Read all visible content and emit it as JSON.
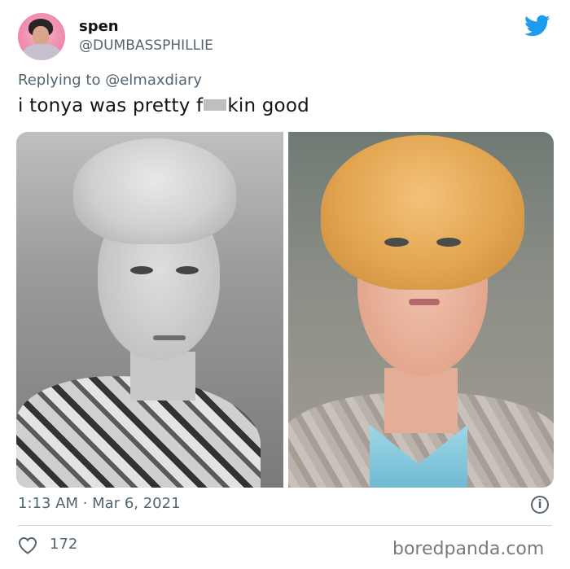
{
  "user": {
    "display_name": "spen",
    "handle": "@DUMBASSPHILLIE"
  },
  "reply": {
    "prefix": "Replying to",
    "mention": "@elmaxdiary"
  },
  "tweet": {
    "text_before": "i tonya was pretty f",
    "text_after": "kin good"
  },
  "meta": {
    "timestamp": "1:13 AM · Mar 6, 2021"
  },
  "engagement": {
    "likes": "172"
  },
  "watermark": "boredpanda.com",
  "icons": {
    "brand": "twitter-bird-icon",
    "info": "info-icon",
    "like": "heart-icon"
  },
  "colors": {
    "twitter_blue": "#1d9bf0",
    "secondary_text": "#536471"
  }
}
